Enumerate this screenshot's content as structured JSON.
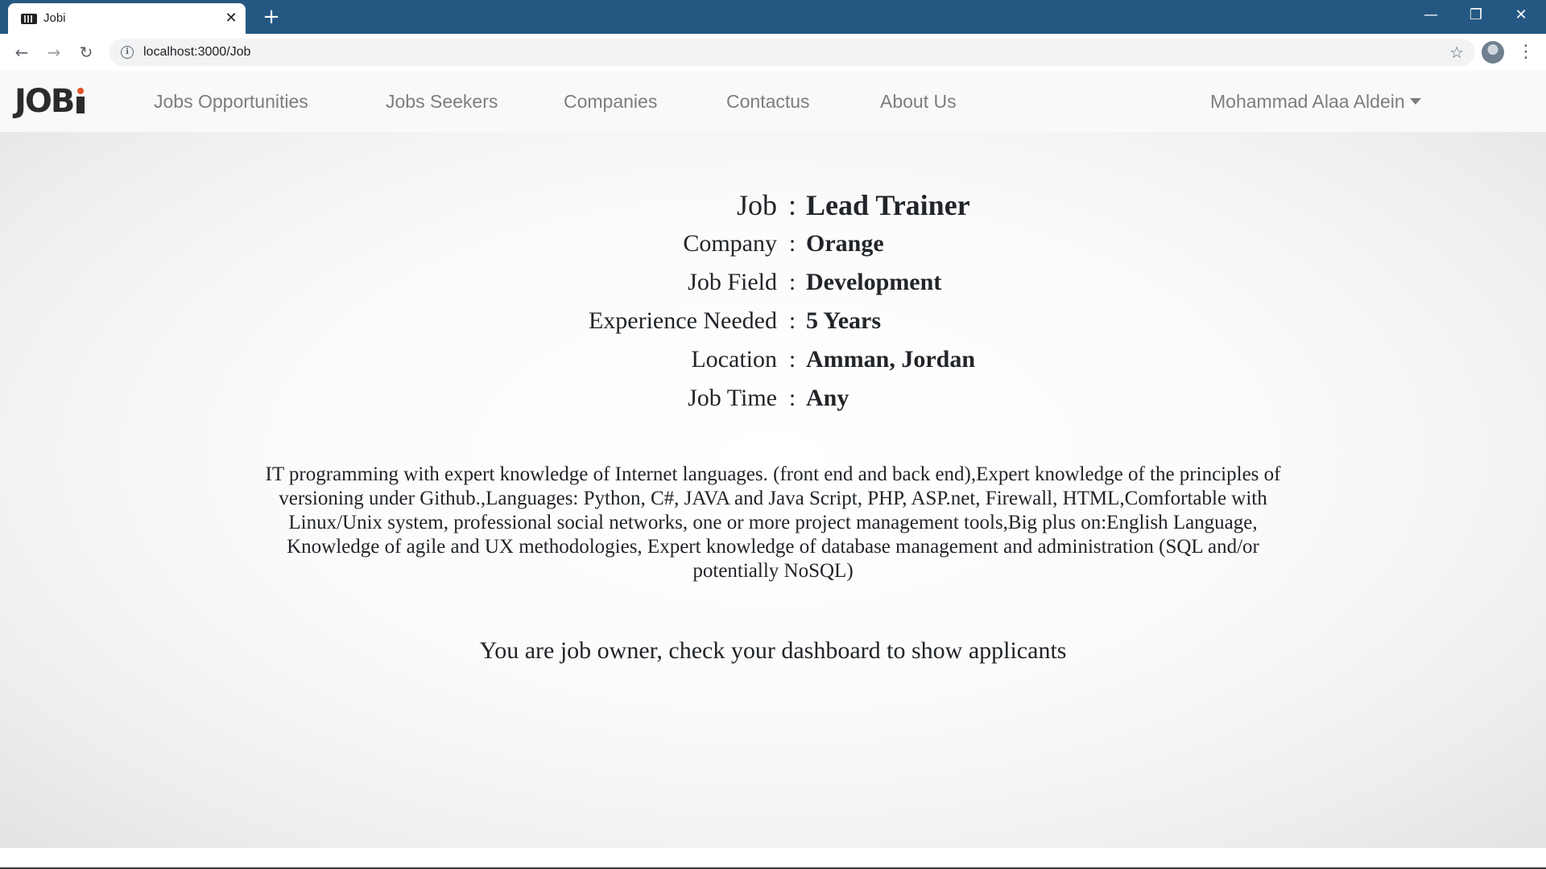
{
  "browser": {
    "tab_title": "Jobi",
    "tab_close": "✕",
    "new_tab": "+",
    "url": "localhost:3000/Job",
    "icons": [
      "favicon-icon",
      "close-icon",
      "plus-icon",
      "minimize-icon",
      "maximize-icon",
      "window-close-icon",
      "back-arrow-icon",
      "forward-arrow-icon",
      "reload-icon",
      "info-icon",
      "star-icon",
      "profile-avatar",
      "more-menu-icon"
    ]
  },
  "navbar": {
    "logo": "JOB",
    "links": [
      "Jobs Opportunities",
      "Jobs Seekers",
      "Companies",
      "Contactus",
      "About Us"
    ],
    "user": "Mohammad Alaa Aldein"
  },
  "job": {
    "separator": ":",
    "rows": [
      {
        "label": "Job",
        "value": "Lead Trainer"
      },
      {
        "label": "Company",
        "value": "Orange"
      },
      {
        "label": "Job Field",
        "value": "Development"
      },
      {
        "label": "Experience Needed",
        "value": "5 Years"
      },
      {
        "label": "Location",
        "value": "Amman, Jordan"
      },
      {
        "label": "Job Time",
        "value": "Any"
      }
    ],
    "description": "IT programming with expert knowledge of Internet languages. (front end and back end),Expert knowledge of the principles of versioning under Github.,Languages: Python, C#, JAVA and Java Script, PHP, ASP.net, Firewall, HTML,Comfortable with Linux/Unix system, professional social networks, one or more project management tools,Big plus on:English Language, Knowledge of agile and UX methodologies, Expert knowledge of database management and administration (SQL and/or potentially NoSQL)",
    "owner_message": "You are job owner, check your dashboard to show applicants"
  },
  "colors": {
    "titlebar": "#245883",
    "navbar_bg": "#f8f9fa",
    "logo_accent": "#e2542a",
    "text": "#212529"
  }
}
